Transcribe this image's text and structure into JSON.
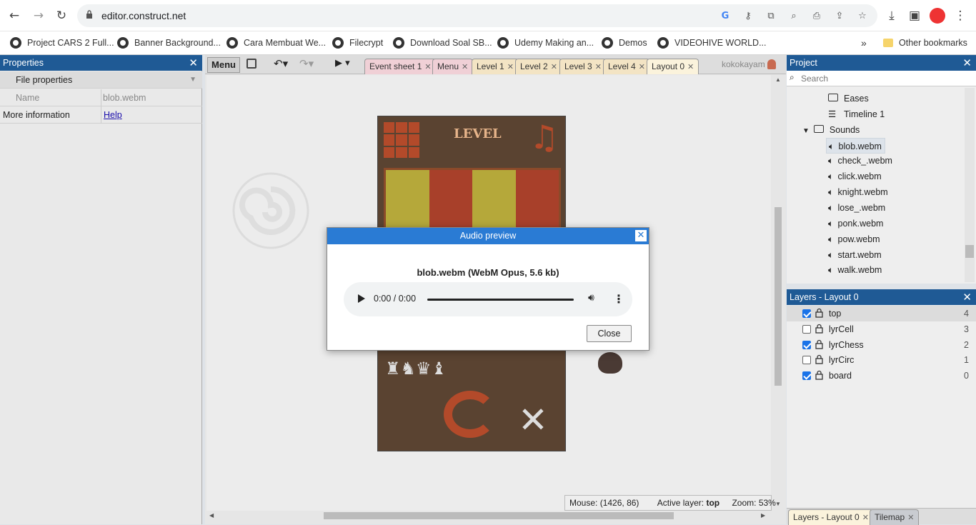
{
  "browser": {
    "url": "editor.construct.net",
    "bookmarks": [
      "Project CARS 2 Full...",
      "Banner Background...",
      "Cara Membuat We...",
      "Filecrypt",
      "Download Soal SB...",
      "Udemy Making an...",
      "Demos",
      "VIDEOHIVE WORLD..."
    ],
    "more": "»",
    "other_bookmarks": "Other bookmarks"
  },
  "properties": {
    "title": "Properties",
    "section": "File properties",
    "name_label": "Name",
    "name_value": "blob.webm",
    "more_info_label": "More information",
    "more_info_link": "Help"
  },
  "editor": {
    "menu_label": "Menu",
    "tabs": [
      "Event sheet 1",
      "Menu",
      "Level 1",
      "Level 2",
      "Level 3",
      "Level 4",
      "Layout 0"
    ],
    "user": "kokokayam",
    "status": {
      "mouse_label": "Mouse:",
      "mouse_value": "(1426, 86)",
      "layer_label": "Active layer:",
      "layer_value": "top",
      "zoom_label": "Zoom:",
      "zoom_value": "53%"
    },
    "level_text": "LEVEL"
  },
  "project": {
    "title": "Project",
    "search_placeholder": "Search",
    "items": [
      "Eases",
      "Timeline 1",
      "Sounds",
      "blob.webm",
      "check_.webm",
      "click.webm",
      "knight.webm",
      "lose_.webm",
      "ponk.webm",
      "pow.webm",
      "start.webm",
      "walk.webm"
    ]
  },
  "layers": {
    "title": "Layers - Layout 0",
    "rows": [
      {
        "name": "top",
        "num": "4",
        "checked": true
      },
      {
        "name": "lyrCell",
        "num": "3",
        "checked": false
      },
      {
        "name": "lyrChess",
        "num": "2",
        "checked": true
      },
      {
        "name": "lyrCirc",
        "num": "1",
        "checked": false
      },
      {
        "name": "board",
        "num": "0",
        "checked": true
      }
    ],
    "bottom_tabs": [
      "Layers - Layout 0",
      "Tilemap"
    ]
  },
  "dialog": {
    "title": "Audio preview",
    "file_info": "blob.webm (WebM Opus, 5.6 kb)",
    "time": "0:00 / 0:00",
    "close_label": "Close"
  }
}
